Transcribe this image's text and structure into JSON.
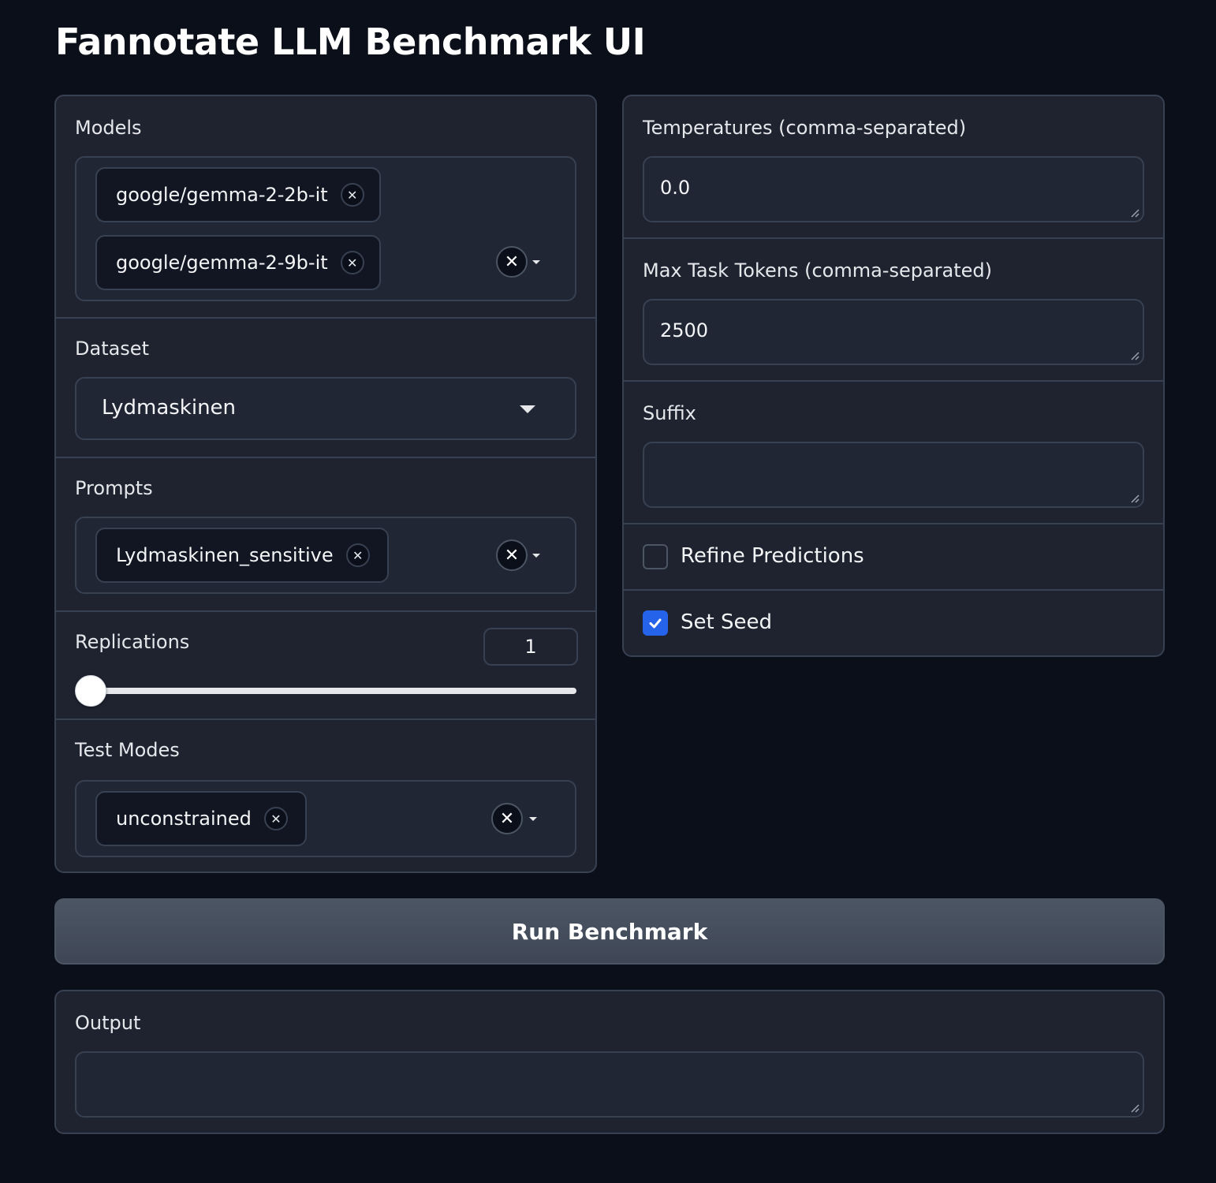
{
  "page_title": "Fannotate LLM Benchmark UI",
  "models": {
    "label": "Models",
    "selected": [
      "google/gemma-2-2b-it",
      "google/gemma-2-9b-it"
    ]
  },
  "dataset": {
    "label": "Dataset",
    "value": "Lydmaskinen"
  },
  "prompts": {
    "label": "Prompts",
    "selected": [
      "Lydmaskinen_sensitive"
    ]
  },
  "replications": {
    "label": "Replications",
    "value": "1",
    "slider_fraction": 0
  },
  "test_modes": {
    "label": "Test Modes",
    "selected": [
      "unconstrained"
    ]
  },
  "temperatures": {
    "label": "Temperatures (comma-separated)",
    "value": "0.0"
  },
  "max_task_tokens": {
    "label": "Max Task Tokens (comma-separated)",
    "value": "2500"
  },
  "suffix": {
    "label": "Suffix",
    "value": ""
  },
  "refine_predictions": {
    "label": "Refine Predictions",
    "checked": false
  },
  "set_seed": {
    "label": "Set Seed",
    "checked": true
  },
  "run_button": {
    "label": "Run Benchmark"
  },
  "output": {
    "label": "Output",
    "value": ""
  },
  "colors": {
    "background": "#0b0f19",
    "panel": "#1f2330",
    "border": "#374151",
    "checkbox_accent": "#2563eb"
  }
}
